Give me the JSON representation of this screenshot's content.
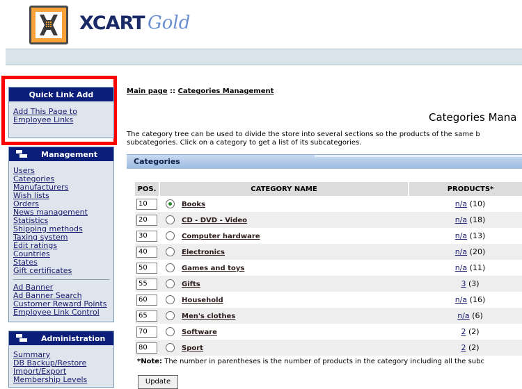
{
  "header": {
    "brand": "XCART",
    "brand_sub": "Gold"
  },
  "quick_link": {
    "title": "Quick Link Add",
    "items": [
      "Add This Page to",
      "Employee Links"
    ]
  },
  "management": {
    "title": "Management",
    "items": [
      "Users",
      "Categories",
      "Manufacturers",
      "Wish lists",
      "Orders",
      "News management",
      "Statistics",
      "Shipping methods",
      "Taxing system",
      "Edit ratings",
      "Countries",
      "States",
      "Gift certificates"
    ],
    "items2": [
      "Ad Banner",
      "Ad Banner Search",
      "Customer Reward Points",
      "Employee Link Control"
    ]
  },
  "administration": {
    "title": "Administration",
    "items": [
      "Summary",
      "DB Backup/Restore",
      "Import/Export",
      "Membership Levels"
    ]
  },
  "breadcrumb": {
    "home": "Main page",
    "sep": " :: ",
    "current": "Categories Management"
  },
  "page": {
    "title": "Categories Mana",
    "desc_line1": "The category tree can be used to divide the store into several sections so the products of the same b",
    "desc_line2": "subcategories. Click on a category to get a list of its subcategories."
  },
  "section": {
    "title": "Categories"
  },
  "table": {
    "headers": {
      "pos": "POS.",
      "name": "CATEGORY NAME",
      "products": "PRODUCTS*"
    },
    "rows": [
      {
        "pos": "10",
        "name": "Books",
        "link": "n/a",
        "count": "(10)",
        "selected": true
      },
      {
        "pos": "20",
        "name": "CD - DVD - Video",
        "link": "n/a",
        "count": "(18)",
        "selected": false
      },
      {
        "pos": "30",
        "name": "Computer hardware",
        "link": "n/a",
        "count": "(13)",
        "selected": false
      },
      {
        "pos": "40",
        "name": "Electronics",
        "link": "n/a",
        "count": "(20)",
        "selected": false
      },
      {
        "pos": "50",
        "name": "Games and toys",
        "link": "n/a",
        "count": "(11)",
        "selected": false
      },
      {
        "pos": "55",
        "name": "Gifts",
        "link": "3",
        "count": "(3)",
        "selected": false
      },
      {
        "pos": "60",
        "name": "Household",
        "link": "n/a",
        "count": "(16)",
        "selected": false
      },
      {
        "pos": "65",
        "name": "Men's clothes",
        "link": "n/a",
        "count": "(6)",
        "selected": false
      },
      {
        "pos": "70",
        "name": "Software",
        "link": "2",
        "count": "(2)",
        "selected": false
      },
      {
        "pos": "80",
        "name": "Sport",
        "link": "2",
        "count": "(2)",
        "selected": false
      }
    ]
  },
  "note": {
    "label": "*Note:",
    "text": " The number in parentheses is the number of products in the category including all the subc"
  },
  "buttons": {
    "update": "Update"
  }
}
